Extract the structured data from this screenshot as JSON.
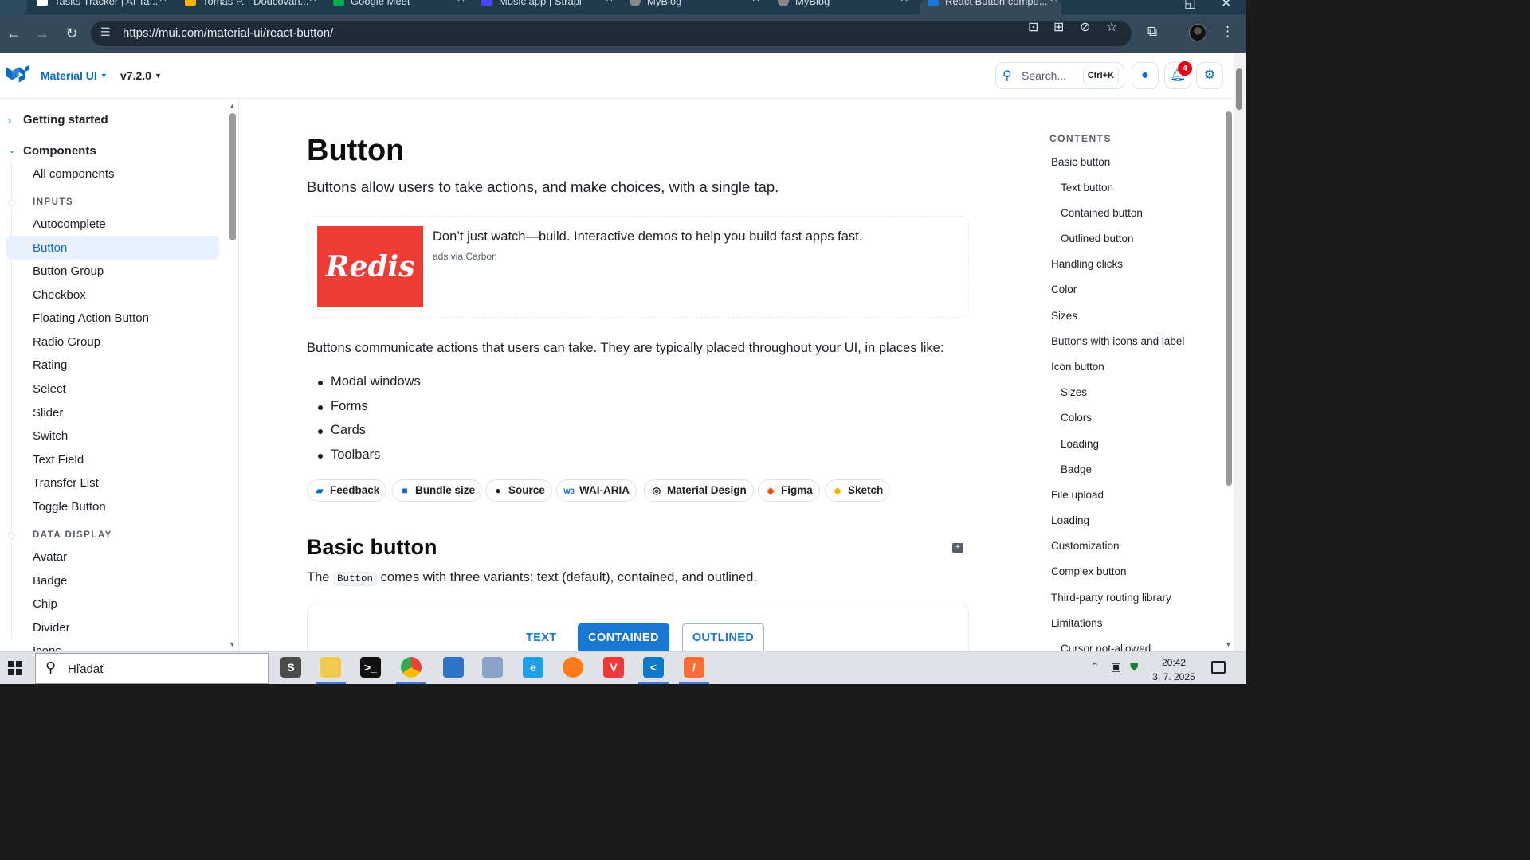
{
  "browser": {
    "tabs": [
      {
        "title": "Tasks Tracker | AI Ta...",
        "fav_color": "#ffffff"
      },
      {
        "title": "Tomas P. - Doucovan...",
        "fav_color": "#f5b400"
      },
      {
        "title": "Google Meet",
        "fav_color": "#00ac47"
      },
      {
        "title": "Music app | Strapi",
        "fav_color": "#4945ff"
      },
      {
        "title": "MyBlog",
        "fav_color": "#888888"
      },
      {
        "title": "MyBlog",
        "fav_color": "#888888"
      },
      {
        "title": "React Button compo...",
        "fav_color": "#1976d2"
      }
    ],
    "url": "https://mui.com/material-ui/react-button/"
  },
  "header": {
    "product": "Material UI",
    "version": "v7.2.0",
    "search_placeholder": "Search...",
    "search_shortcut": "Ctrl+K",
    "notification_count": "4"
  },
  "sidebar": {
    "groups": [
      {
        "label": "Getting started"
      },
      {
        "label": "Components"
      }
    ],
    "all_components": "All components",
    "inputs_label": "INPUTS",
    "inputs": [
      "Autocomplete",
      "Button",
      "Button Group",
      "Checkbox",
      "Floating Action Button",
      "Radio Group",
      "Rating",
      "Select",
      "Slider",
      "Switch",
      "Text Field",
      "Transfer List",
      "Toggle Button"
    ],
    "data_display_label": "DATA DISPLAY",
    "data_display": [
      "Avatar",
      "Badge",
      "Chip",
      "Divider",
      "Icons"
    ],
    "selected": "Button"
  },
  "main": {
    "title": "Button",
    "lead": "Buttons allow users to take actions, and make choices, with a single tap.",
    "ad": {
      "brand": "Redis",
      "text": "Don’t just watch—build. Interactive demos to help you build fast apps fast.",
      "via": "ads via Carbon"
    },
    "intro": "Buttons communicate actions that users can take. They are typically placed throughout your UI, in places like:",
    "bullets": [
      "Modal windows",
      "Forms",
      "Cards",
      "Toolbars"
    ],
    "chips": [
      {
        "label": "Feedback",
        "icon": "feedback-icon"
      },
      {
        "label": "Bundle size",
        "icon": "bundle-icon"
      },
      {
        "label": "Source",
        "icon": "github-icon"
      },
      {
        "label": "WAI-ARIA",
        "icon": "w3c-icon"
      },
      {
        "label": "Material Design",
        "icon": "material-icon"
      },
      {
        "label": "Figma",
        "icon": "figma-icon"
      },
      {
        "label": "Sketch",
        "icon": "sketch-icon"
      }
    ],
    "section_title": "Basic button",
    "section_text_before": "The",
    "section_code": "Button",
    "section_text_after": "comes with three variants: text (default), contained, and outlined.",
    "demo_buttons": {
      "text": "TEXT",
      "contained": "CONTAINED",
      "outlined": "OUTLINED"
    }
  },
  "toc": {
    "title": "CONTENTS",
    "items": [
      {
        "label": "Basic button",
        "sub": false
      },
      {
        "label": "Text button",
        "sub": true
      },
      {
        "label": "Contained button",
        "sub": true
      },
      {
        "label": "Outlined button",
        "sub": true
      },
      {
        "label": "Handling clicks",
        "sub": false
      },
      {
        "label": "Color",
        "sub": false
      },
      {
        "label": "Sizes",
        "sub": false
      },
      {
        "label": "Buttons with icons and label",
        "sub": false
      },
      {
        "label": "Icon button",
        "sub": false
      },
      {
        "label": "Sizes",
        "sub": true
      },
      {
        "label": "Colors",
        "sub": true
      },
      {
        "label": "Loading",
        "sub": true
      },
      {
        "label": "Badge",
        "sub": true
      },
      {
        "label": "File upload",
        "sub": false
      },
      {
        "label": "Loading",
        "sub": false
      },
      {
        "label": "Customization",
        "sub": false
      },
      {
        "label": "Complex button",
        "sub": false
      },
      {
        "label": "Third-party routing library",
        "sub": false
      },
      {
        "label": "Limitations",
        "sub": false
      },
      {
        "label": "Cursor not-allowed",
        "sub": true
      }
    ]
  },
  "taskbar": {
    "search_placeholder": "Hľadať",
    "time": "20:42",
    "date": "3. 7. 2025",
    "apps": [
      {
        "name": "sublime-text",
        "color": "#4b4b4b",
        "glyph": "S"
      },
      {
        "name": "file-explorer",
        "color": "#f2c94c",
        "glyph": ""
      },
      {
        "name": "terminal",
        "color": "#111111",
        "glyph": ">_"
      },
      {
        "name": "chrome",
        "color": "#ffffff",
        "glyph": ""
      },
      {
        "name": "teams",
        "color": "#2f73c9",
        "glyph": ""
      },
      {
        "name": "remote-desktop",
        "color": "#8aa2c8",
        "glyph": ""
      },
      {
        "name": "internet-explorer",
        "color": "#1ea0e8",
        "glyph": "e"
      },
      {
        "name": "firefox",
        "color": "#ff7a1a",
        "glyph": ""
      },
      {
        "name": "vivaldi",
        "color": "#ef3939",
        "glyph": "V"
      },
      {
        "name": "vscode",
        "color": "#0f7acc",
        "glyph": "<"
      },
      {
        "name": "postman",
        "color": "#ff6c37",
        "glyph": "/"
      }
    ]
  }
}
